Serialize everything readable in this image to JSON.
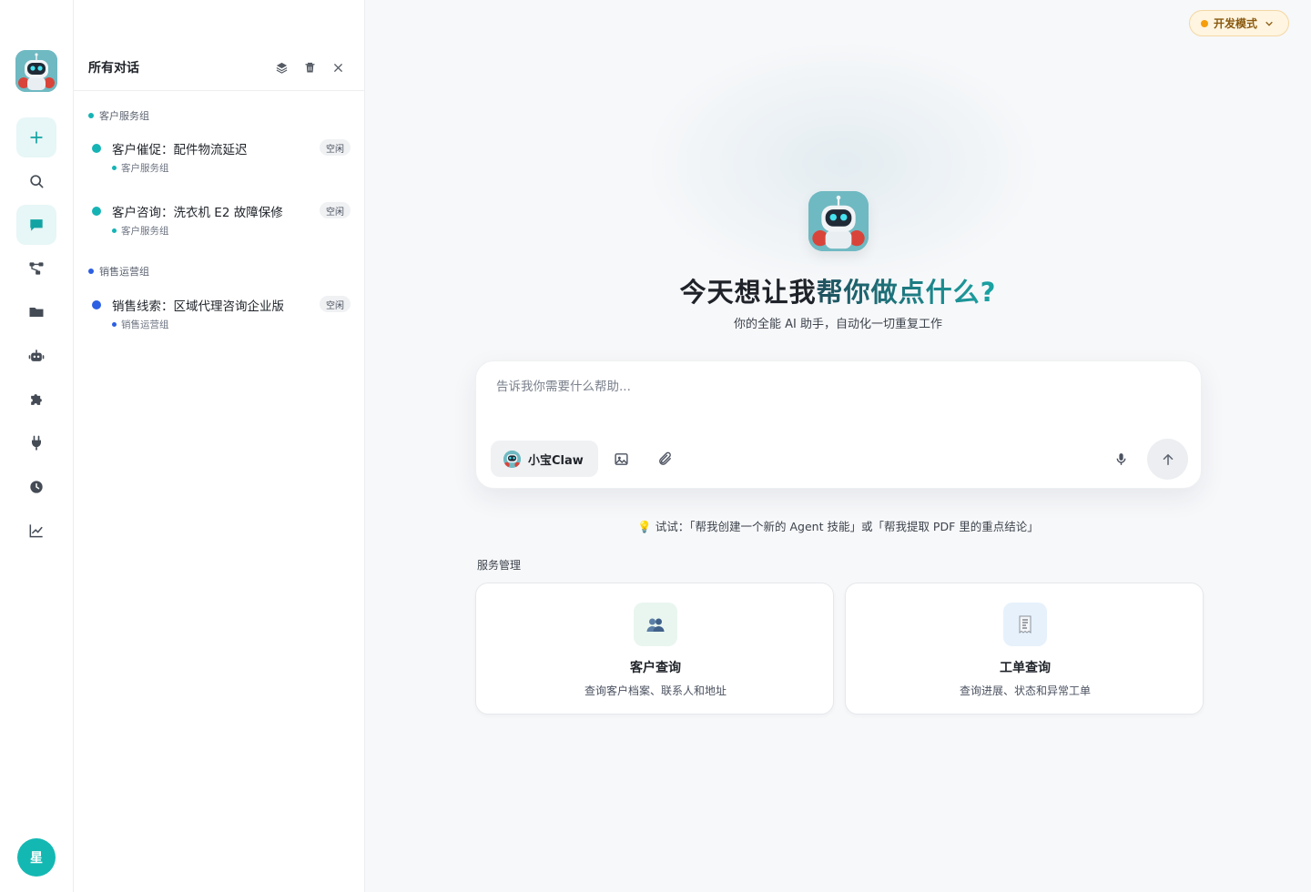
{
  "rail": {
    "avatar_label": "星",
    "items": [
      {
        "name": "new-chat",
        "icon": "plus-icon"
      },
      {
        "name": "search",
        "icon": "search-icon"
      },
      {
        "name": "chat",
        "icon": "chat-bubble-icon"
      },
      {
        "name": "workflow",
        "icon": "workflow-icon"
      },
      {
        "name": "files",
        "icon": "folder-icon"
      },
      {
        "name": "agents",
        "icon": "robot-icon"
      },
      {
        "name": "plugins",
        "icon": "puzzle-icon"
      },
      {
        "name": "integrations",
        "icon": "plug-icon"
      },
      {
        "name": "history",
        "icon": "clock-icon"
      },
      {
        "name": "analytics",
        "icon": "chart-icon"
      }
    ]
  },
  "panel": {
    "title": "所有对话",
    "tools": [
      "layers-icon",
      "trash-icon",
      "close-icon"
    ],
    "groups": [
      {
        "label": "客户服务组",
        "color": "#16b3b5",
        "conversations": [
          {
            "title": "客户催促：配件物流延迟",
            "sub": "客户服务组",
            "status": "空闲"
          },
          {
            "title": "客户咨询：洗衣机 E2 故障保修",
            "sub": "客户服务组",
            "status": "空闲"
          }
        ]
      },
      {
        "label": "销售运营组",
        "color": "#2d5fe3",
        "conversations": [
          {
            "title": "销售线索：区域代理咨询企业版",
            "sub": "销售运营组",
            "status": "空闲"
          }
        ]
      }
    ]
  },
  "main": {
    "dev_mode_label": "开发模式",
    "hero": {
      "title_plain": "今天想让我",
      "title_accent": "帮你做点什么?",
      "subtitle": "你的全能 AI 助手，自动化一切重复工作"
    },
    "composer": {
      "placeholder": "告诉我你需要什么帮助...",
      "agent_label": "小宝Claw"
    },
    "hint": "💡 试试：「帮我创建一个新的 Agent 技能」或「帮我提取 PDF 里的重点结论」",
    "section_label": "服务管理",
    "cards": [
      {
        "title": "客户查询",
        "desc": "查询客户档案、联系人和地址",
        "icon": "people-icon"
      },
      {
        "title": "工单查询",
        "desc": "查询进展、状态和异常工单",
        "icon": "receipt-icon"
      }
    ]
  },
  "colors": {
    "accent": "#13a3a3",
    "accent_bg": "#e7f6f6",
    "dev_badge_bg": "#fff5e0",
    "dev_dot": "#f59e0b",
    "group_teal": "#16b3b5",
    "group_blue": "#2d5fe3"
  }
}
